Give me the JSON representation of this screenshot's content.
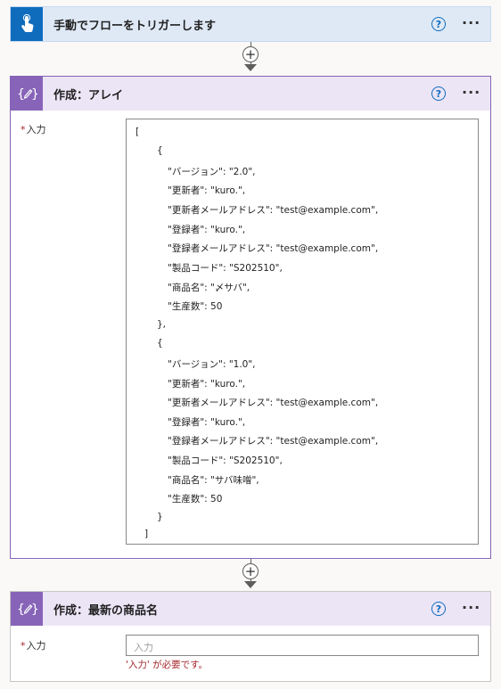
{
  "trigger": {
    "title": "手動でフローをトリガーします",
    "icon": "hand-touch-icon",
    "accent": "#0f6cbd",
    "help": "?",
    "more": "···"
  },
  "compose_array": {
    "title": "作成：アレイ",
    "icon": "compose-icon",
    "accent": "#8764b8",
    "help": "?",
    "more": "···",
    "input_label": "入力",
    "required_mark": "*",
    "code_lines": [
      "[",
      "{",
      "\"バージョン\": \"2.0\",",
      "\"更新者\": \"kuro.\",",
      "\"更新者メールアドレス\": \"test@example.com\",",
      "\"登録者\": \"kuro.\",",
      "\"登録者メールアドレス\": \"test@example.com\",",
      "\"製品コード\": \"S202510\",",
      "\"商品名\": \"〆サバ\",",
      "\"生産数\": 50",
      "},",
      "{",
      "\"バージョン\": \"1.0\",",
      "\"更新者\": \"kuro.\",",
      "\"更新者メールアドレス\": \"test@example.com\",",
      "\"登録者\": \"kuro.\",",
      "\"登録者メールアドレス\": \"test@example.com\",",
      "\"製品コード\": \"S202510\",",
      "\"商品名\": \"サバ味噌\",",
      "\"生産数\": 50",
      "}",
      "]"
    ]
  },
  "compose_latest": {
    "title": "作成：最新の商品名",
    "icon": "compose-icon",
    "accent": "#8764b8",
    "help": "?",
    "more": "···",
    "input_label": "入力",
    "required_mark": "*",
    "input_placeholder": "入力",
    "error_text": "'入力' が必要です。"
  },
  "connector": {
    "add_label": "+"
  }
}
